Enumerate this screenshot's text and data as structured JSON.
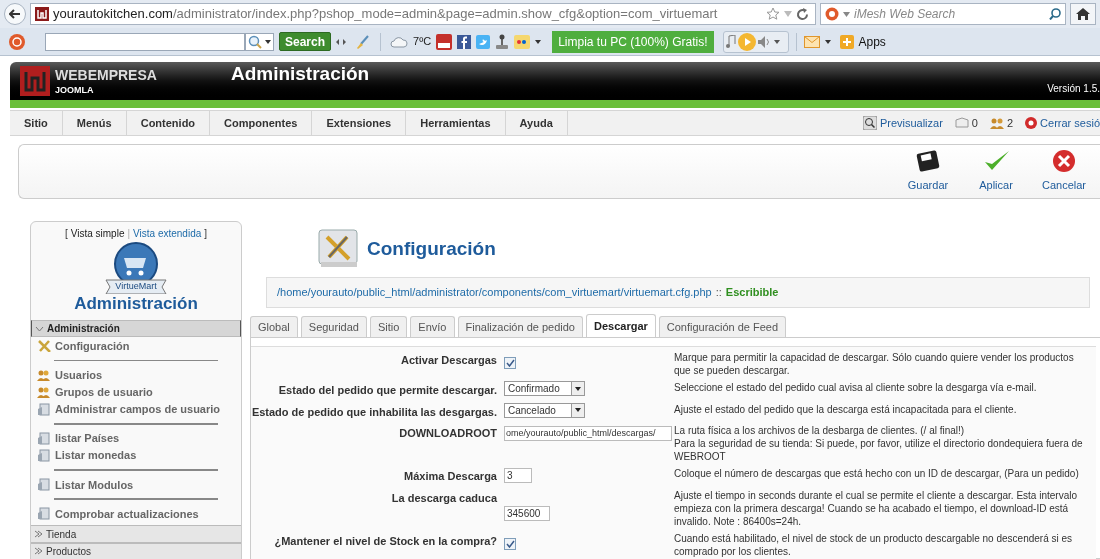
{
  "browser": {
    "url_host": "yourautokitchen.com",
    "url_path": "/administrator/index.php?pshop_mode=admin&page=admin.show_cfg&option=com_virtuemart",
    "search_placeholder": "iMesh Web Search"
  },
  "browser_toolbar": {
    "search_button": "Search",
    "weather": "7ºC",
    "promo": "Limpia tu PC (100%) Gratis!",
    "apps": "Apps"
  },
  "header": {
    "brand": "WEBEMPRESA",
    "brand_sub": "JOOMLA",
    "title": "Administración",
    "version": "Versión 1.5."
  },
  "menu": [
    "Sitio",
    "Menús",
    "Contenido",
    "Componentes",
    "Extensiones",
    "Herramientas",
    "Ayuda"
  ],
  "status_links": [
    {
      "kind": "preview",
      "label": "Previsualizar"
    },
    {
      "kind": "messages",
      "label": "0"
    },
    {
      "kind": "users",
      "label": "2"
    },
    {
      "kind": "logout",
      "label": "Cerrar sesió"
    }
  ],
  "actions": [
    {
      "kind": "save",
      "label": "Guardar"
    },
    {
      "kind": "apply",
      "label": "Aplicar"
    },
    {
      "kind": "cancel",
      "label": "Cancelar"
    }
  ],
  "sidebar": {
    "view_open": "[",
    "view_links": [
      "Vista simple",
      "Vista extendida"
    ],
    "view_separator": "|",
    "view_close": "]",
    "logo_badge": "VirtueMart",
    "title": "Administración",
    "sections": [
      {
        "title": "Administración",
        "expanded": true,
        "groups": [
          [
            {
              "kind": "tools",
              "label": "Configuración"
            }
          ],
          [
            {
              "kind": "users",
              "label": "Usuarios"
            },
            {
              "kind": "users",
              "label": "Grupos de usuario"
            },
            {
              "kind": "doc",
              "label": "Administrar campos de usuario"
            }
          ],
          [
            {
              "kind": "doc",
              "label": "listar Países"
            },
            {
              "kind": "doc",
              "label": "Listar monedas"
            }
          ],
          [
            {
              "kind": "doc",
              "label": "Listar Modulos"
            }
          ],
          [
            {
              "kind": "doc",
              "label": "Comprobar actualizaciones"
            }
          ]
        ]
      },
      {
        "title": "Tienda",
        "expanded": false
      },
      {
        "title": "Productos",
        "expanded": false
      }
    ]
  },
  "main": {
    "title": "Configuración",
    "path": "/home/yourauto/public_html/administrator/components/com_virtuemart/virtuemart.cfg.php",
    "path_separator": "::",
    "path_status": "Escribible",
    "tabs": [
      {
        "label": "Global",
        "selected": false
      },
      {
        "label": "Seguridad",
        "selected": false
      },
      {
        "label": "Sitio",
        "selected": false
      },
      {
        "label": "Envío",
        "selected": false
      },
      {
        "label": "Finalización de pedido",
        "selected": false
      },
      {
        "label": "Descargar",
        "selected": true
      },
      {
        "label": "Configuración de Feed",
        "selected": false
      }
    ],
    "rows": [
      {
        "kind": "checkbox",
        "label": "Activar Descargas",
        "checked": true,
        "description": "Marque para permitir la capacidad de descargar. Sólo cuando quiere vender los productos que se pueden descargar."
      },
      {
        "kind": "select",
        "label": "Estado del pedido que permite descargar.",
        "value": "Confirmado",
        "description": "Seleccione el estado del pedido cual avisa al cliente sobre la desgarga vía e-mail."
      },
      {
        "kind": "select",
        "label": "Estado de pedido que inhabilita las desgargas.",
        "value": "Cancelado",
        "description": "Ajuste el estado del pedido que la descarga está incapacitada para el cliente."
      },
      {
        "kind": "text",
        "label": "DOWNLOADROOT",
        "value": "ome/yourauto/public_html/descargas/",
        "description": "La ruta física a los archivos de la desbarga de clientes. (/ al final!)\nPara la seguridad de su tienda: Si puede, por favor, utilize el directorio dondequiera fuera de WEBROOT"
      },
      {
        "kind": "short",
        "label": "Máxima Descarga",
        "value": "3",
        "description": "Coloque el número de descargas que está hecho con un ID de descargar, (Para un pedido)"
      },
      {
        "kind": "below",
        "label": "La descarga caduca",
        "value": "345600",
        "description": "Ajuste el tiempo in seconds durante el cual se permite el cliente a descargar. Esta intervalo empieza con la primera descarga! Cuando se ha acabado el tiempo, el download-ID está invalido. Note : 86400s=24h."
      },
      {
        "kind": "checkbox",
        "label": "¿Mantener el nivel de Stock en la compra?",
        "checked": true,
        "description": "Cuando está habilitado, el nivel de stock de un producto descargable no descenderá si es comprado por los clientes."
      }
    ]
  }
}
